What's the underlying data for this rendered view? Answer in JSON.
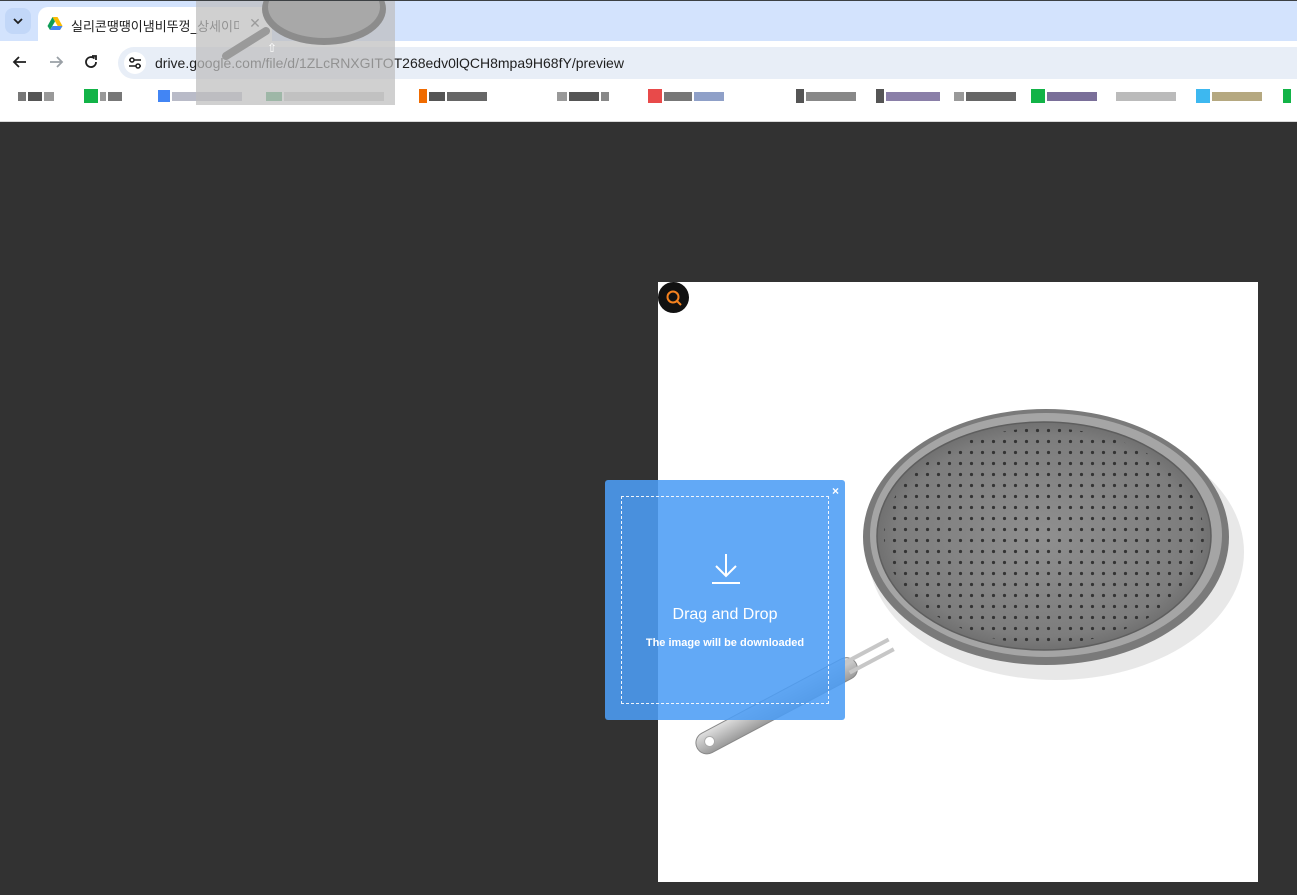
{
  "browser": {
    "tab": {
      "title": "실리콘땡땡이냄비뚜껑_상세이미",
      "favicon": "google-drive-icon",
      "close_label": "✕"
    },
    "new_tab_label": "+",
    "url": "drive.google.com/file/d/1ZLcRNXGITOT268edv0lQCH8mpa9H68fY/preview"
  },
  "overlay": {
    "close_label": "×",
    "title": "Drag and Drop",
    "subtitle": "The image will be downloaded",
    "icon": "download-icon",
    "accent": "#4c9df5"
  },
  "viewer": {
    "background": "#323232",
    "search_icon": "search-icon",
    "search_icon_color": "#f5821f"
  }
}
